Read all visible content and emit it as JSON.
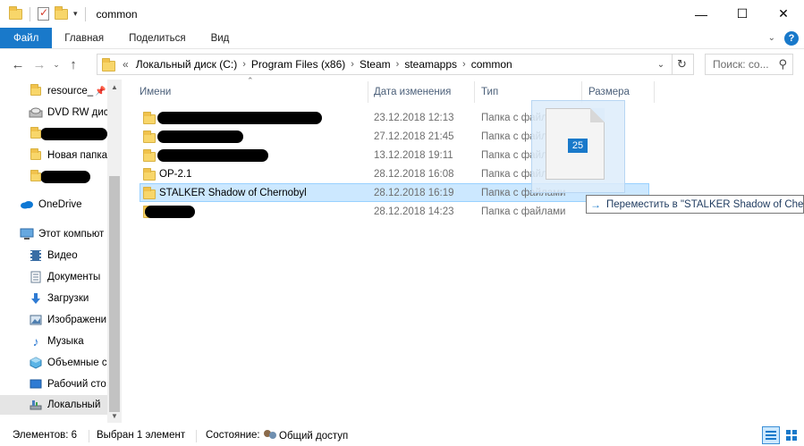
{
  "window": {
    "title": "common",
    "minimize_glyph": "—",
    "maximize_glyph": "☐",
    "close_glyph": "✕"
  },
  "ribbon": {
    "tabs": [
      "Файл",
      "Главная",
      "Поделиться",
      "Вид"
    ]
  },
  "address": {
    "overflow": "«",
    "crumbs": [
      "Локальный диск (C:)",
      "Program Files (x86)",
      "Steam",
      "steamapps",
      "common"
    ],
    "separator": "›"
  },
  "search": {
    "placeholder": "Поиск: co..."
  },
  "sidebar": {
    "items": [
      {
        "label": "resource_",
        "icon": "folder-icon",
        "pinned": true
      },
      {
        "label": "DVD RW дис",
        "icon": "dvd-drive-icon"
      },
      {
        "label": "",
        "icon": "folder-icon",
        "redacted": true
      },
      {
        "label": "Новая папка",
        "icon": "folder-icon"
      },
      {
        "label": "",
        "icon": "folder-icon",
        "redacted": true
      },
      {
        "label": "OneDrive",
        "icon": "onedrive-icon"
      },
      {
        "label": "Этот компьют",
        "icon": "this-pc-icon"
      },
      {
        "label": "Видео",
        "icon": "video-icon"
      },
      {
        "label": "Документы",
        "icon": "documents-icon"
      },
      {
        "label": "Загрузки",
        "icon": "downloads-icon"
      },
      {
        "label": "Изображени",
        "icon": "pictures-icon"
      },
      {
        "label": "Музыка",
        "icon": "music-icon"
      },
      {
        "label": "Объемные с",
        "icon": "3d-objects-icon"
      },
      {
        "label": "Рабочий сто",
        "icon": "desktop-icon"
      },
      {
        "label": "Локальный",
        "icon": "local-disk-icon",
        "selected": true
      }
    ]
  },
  "columns": {
    "name": "Имени",
    "date": "Дата изменения",
    "type": "Тип",
    "size": "Размера"
  },
  "files": [
    {
      "name": "",
      "redacted": true,
      "date": "23.12.2018 12:13",
      "type": "Папка с файлами"
    },
    {
      "name": "",
      "redacted": true,
      "date": "27.12.2018 21:45",
      "type": "Папка с файлами"
    },
    {
      "name": "",
      "redacted": true,
      "date": "13.12.2018 19:11",
      "type": "Папка с файлами"
    },
    {
      "name": "OP-2.1",
      "date": "28.12.2018 16:08",
      "type": "Папка с файлами"
    },
    {
      "name": "STALKER Shadow of Chernobyl",
      "date": "28.12.2018 16:19",
      "type": "Папка с файлами",
      "selected": true
    },
    {
      "name": "",
      "redacted": true,
      "date": "28.12.2018 14:23",
      "type": "Папка с файлами"
    }
  ],
  "drag": {
    "count": "25",
    "tooltip": "Переместить в \"STALKER Shadow of Chernobyl\""
  },
  "status": {
    "items_count": "Элементов: 6",
    "selected": "Выбран 1 элемент",
    "state_label": "Состояние:",
    "state_value": "Общий доступ"
  },
  "colors": {
    "accent": "#1979ca",
    "selection": "#cce8ff",
    "folder": "#f8d66a"
  }
}
